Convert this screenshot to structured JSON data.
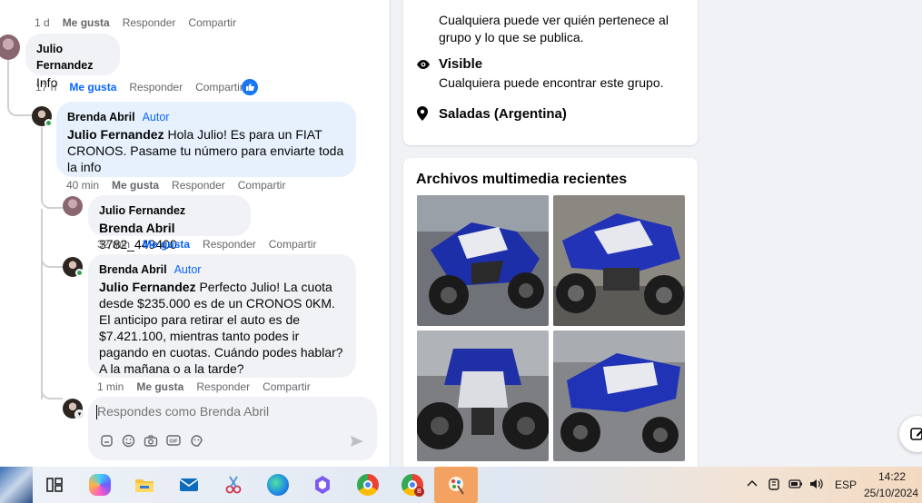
{
  "comments": {
    "top_meta": {
      "time": "1 d",
      "like": "Me gusta",
      "reply": "Responder",
      "share": "Compartir"
    },
    "julio_comment": {
      "author": "Julio Fernandez",
      "text": "Info",
      "time": "17 h",
      "like": "Me gusta",
      "reply": "Responder",
      "share": "Compartir"
    },
    "brenda_reply1": {
      "author": "Brenda Abril",
      "tag": "Autor",
      "mention": "Julio Fernandez",
      "text": " Hola Julio! Es para un FIAT CRONOS. Pasame tu número para enviarte toda la info",
      "time": "40 min",
      "like": "Me gusta",
      "reply": "Responder",
      "share": "Compartir"
    },
    "julio_reply": {
      "author": "Julio Fernandez",
      "mention": "Brenda Abril",
      "text": " 3782_449400",
      "time": "32 min",
      "like": "Me gusta",
      "reply": "Responder",
      "share": "Compartir"
    },
    "brenda_reply2": {
      "author": "Brenda Abril",
      "tag": "Autor",
      "mention": "Julio Fernandez",
      "text": " Perfecto Julio! La cuota desde $235.000 es de un CRONOS 0KM. El anticipo para retirar el auto es de $7.421.100, mientras tanto podes ir pagando en cuotas. Cuándo podes hablar? A la mañana o a la tarde?",
      "time": "1 min",
      "like": "Me gusta",
      "reply": "Responder",
      "share": "Compartir"
    },
    "reply_box": {
      "placeholder": "Respondes como Brenda Abril"
    }
  },
  "group_info": {
    "public_desc": "Cualquiera puede ver quién pertenece al grupo y lo que se publica.",
    "visible_title": "Visible",
    "visible_desc": "Cualquiera puede encontrar este grupo.",
    "location": "Saladas (Argentina)"
  },
  "media": {
    "title": "Archivos multimedia recientes",
    "photos": [
      "atv-photo-1",
      "atv-photo-2",
      "atv-photo-3",
      "atv-photo-4"
    ]
  },
  "taskbar": {
    "lang": "ESP",
    "time": "14:22",
    "date": "25/10/2024"
  },
  "colors": {
    "accent": "#0866ff",
    "author_bubble": "#e7f1fd",
    "bubble": "#f0f2f5"
  }
}
